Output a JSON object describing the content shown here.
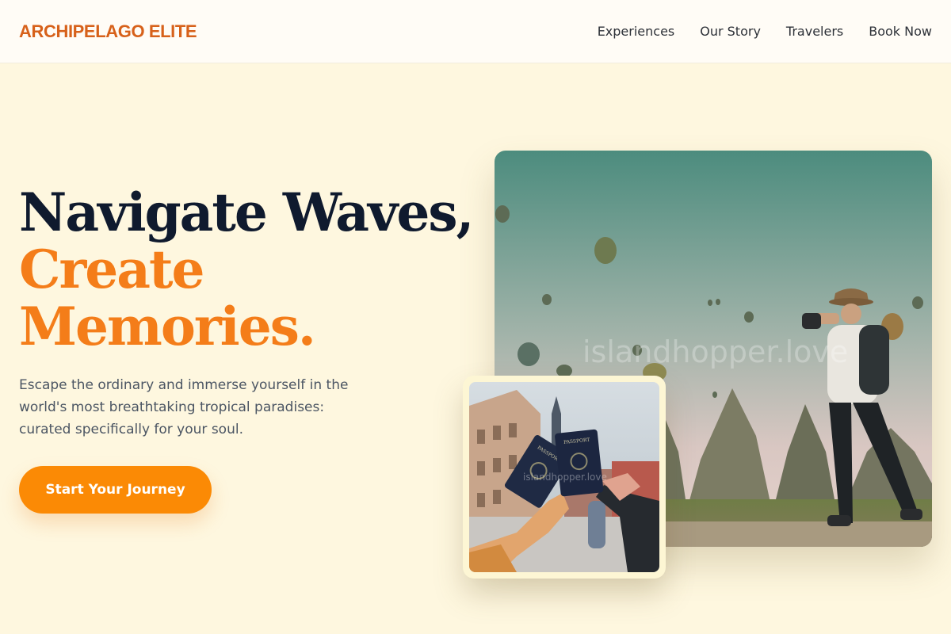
{
  "header": {
    "brand": "ARCHIPELAGO ELITE",
    "nav": [
      "Experiences",
      "Our Story",
      "Travelers",
      "Book Now"
    ]
  },
  "hero": {
    "headline_line1": "Navigate Waves,",
    "headline_line2": "Create",
    "headline_line3": "Memories.",
    "description": "Escape the ordinary and immerse yourself in the world's most breathtaking tropical paradises: curated specifically for your soul.",
    "cta": "Start Your Journey"
  },
  "images": {
    "main_watermark": "islandhopper.love",
    "passport_label": "PASSPORT"
  },
  "colors": {
    "brand": "#d7611a",
    "accent": "#f47d19",
    "cta": "#fb8a05",
    "background": "#fef7df",
    "headline": "#0f1a2e"
  }
}
